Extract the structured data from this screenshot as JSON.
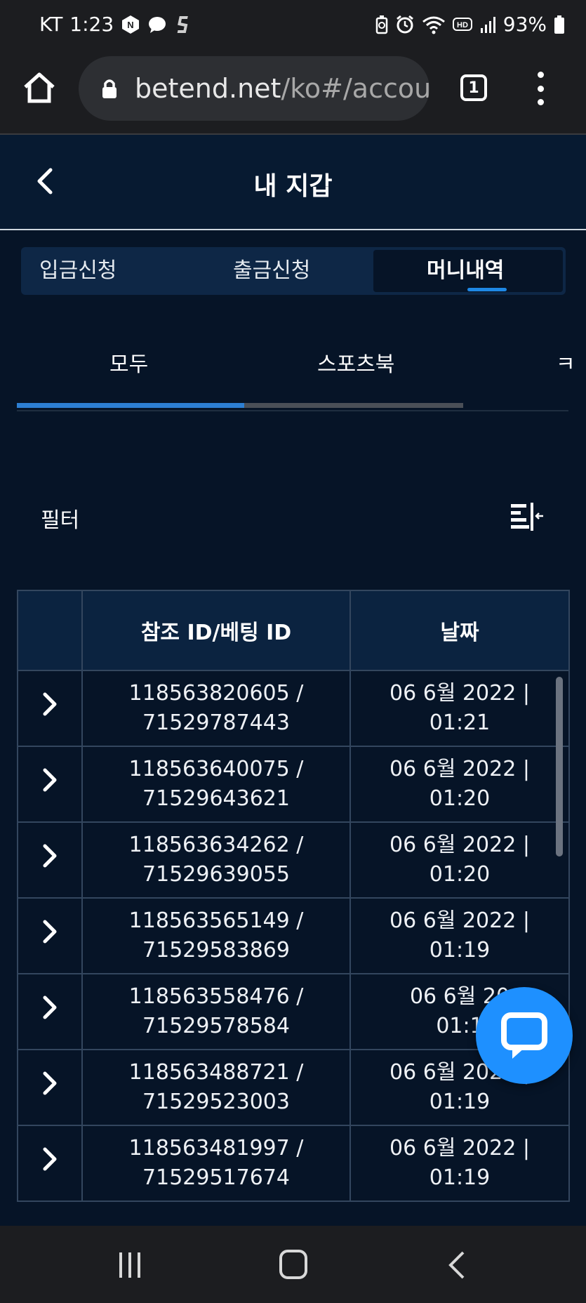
{
  "status_bar": {
    "carrier": "KT",
    "time": "1:23",
    "battery": "93%",
    "left_icons": [
      "n-app-icon",
      "chat-bubble-icon",
      "s-app-icon"
    ],
    "right_icons": [
      "battery-saver-icon",
      "alarm-icon",
      "wifi-icon",
      "hd-icon",
      "signal-icon",
      "battery-icon"
    ]
  },
  "browser": {
    "url_main": "betend.net",
    "url_rest": "/ko#/accou",
    "tab_count": "1"
  },
  "header": {
    "title": "내 지갑"
  },
  "segments": {
    "items": [
      "입금신청",
      "출금신청",
      "머니내역"
    ],
    "active_index": 2
  },
  "subtabs": {
    "items": [
      "모두",
      "스포츠북",
      "ㅋ"
    ],
    "active_index": 0
  },
  "filter": {
    "label": "필터"
  },
  "table": {
    "headers": [
      "",
      "참조 ID/베팅 ID",
      "날짜"
    ],
    "rows": [
      {
        "ref_id": "118563820605 /",
        "bet_id": "71529787443",
        "date": "06 6월 2022 |",
        "time": "01:21"
      },
      {
        "ref_id": "118563640075 /",
        "bet_id": "71529643621",
        "date": "06 6월 2022 |",
        "time": "01:20"
      },
      {
        "ref_id": "118563634262 /",
        "bet_id": "71529639055",
        "date": "06 6월 2022 |",
        "time": "01:20"
      },
      {
        "ref_id": "118563565149 /",
        "bet_id": "71529583869",
        "date": "06 6월 2022 |",
        "time": "01:19"
      },
      {
        "ref_id": "118563558476 /",
        "bet_id": "71529578584",
        "date": "06 6월 20",
        "time": "01:1"
      },
      {
        "ref_id": "118563488721 /",
        "bet_id": "71529523003",
        "date": "06 6월 2022 |",
        "time": "01:19"
      },
      {
        "ref_id": "118563481997 /",
        "bet_id": "71529517674",
        "date": "06 6월 2022 |",
        "time": "01:19"
      }
    ]
  },
  "colors": {
    "background": "#061427",
    "header": "#071a31",
    "accent": "#1e88e5",
    "chat_button": "#1e90ff",
    "system_bar": "#1c1d20"
  }
}
